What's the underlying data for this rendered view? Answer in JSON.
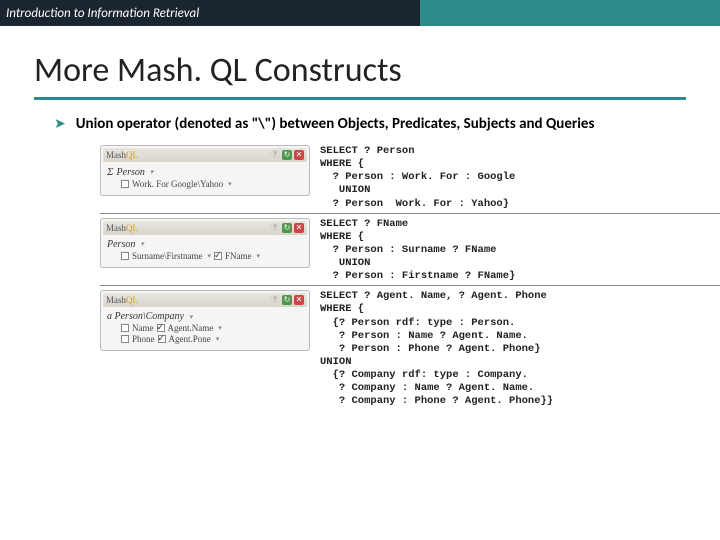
{
  "header": {
    "course": "Introduction to Information Retrieval"
  },
  "title": "More Mash. QL Constructs",
  "bullet": "Union operator (denoted as \"\\\") between Objects, Predicates, Subjects and Queries",
  "panels": {
    "brand_mash": "Mash",
    "brand_ql": "QL"
  },
  "ex1": {
    "header": "Person",
    "line": "Work. For  Google\\Yahoo",
    "query": "SELECT ? Person\nWHERE {\n  ? Person : Work. For : Google\n   UNION\n  ? Person  Work. For : Yahoo}"
  },
  "ex2": {
    "header": "Person",
    "line_pred": "Surname\\Firstname",
    "line_obj": "FName",
    "query": "SELECT ? FName\nWHERE {\n  ? Person : Surname ? FName\n   UNION\n  ? Person : Firstname ? FName}"
  },
  "ex3": {
    "header": "a Person\\Company",
    "l1_pred": "Name",
    "l1_obj": "Agent.Name",
    "l2_pred": "Phone",
    "l2_obj": "Agent.Pone",
    "query": "SELECT ? Agent. Name, ? Agent. Phone\nWHERE {\n  {? Person rdf: type : Person.\n   ? Person : Name ? Agent. Name.\n   ? Person : Phone ? Agent. Phone}\nUNION\n  {? Company rdf: type : Company.\n   ? Company : Name ? Agent. Name.\n   ? Company : Phone ? Agent. Phone}}"
  }
}
